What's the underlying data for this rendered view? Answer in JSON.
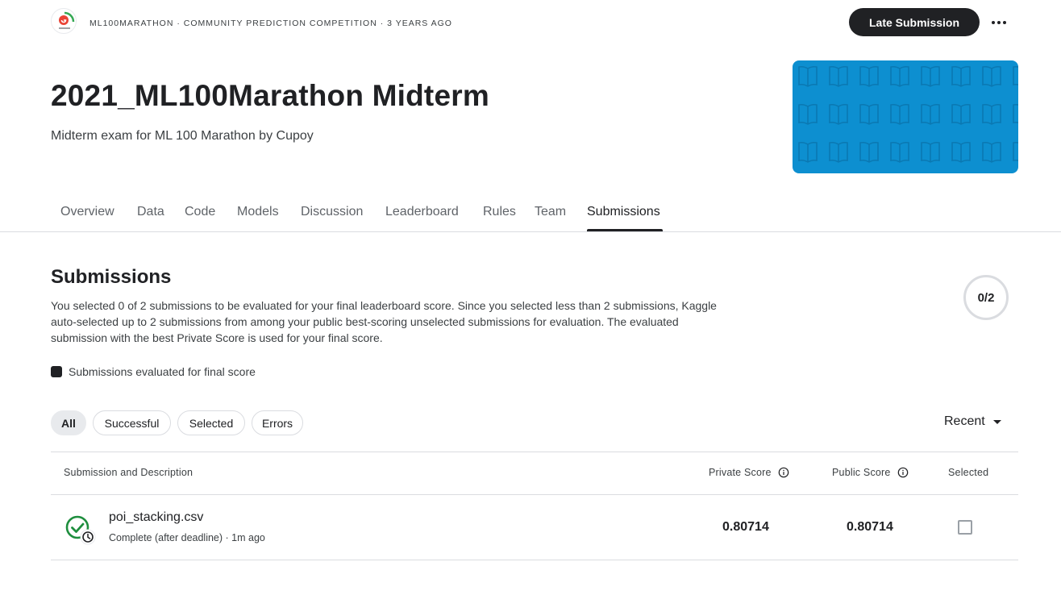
{
  "app": {
    "breadcrumb": "ML100MARATHON · COMMUNITY PREDICTION COMPETITION · 3 YEARS AGO",
    "logo_icon": "cupoy-logo",
    "late_submission_label": "Late Submission",
    "more_icon": "more-horizontal-icon"
  },
  "header": {
    "title": "2021_ML100Marathon Midterm",
    "subtitle": "Midterm exam for ML 100 Marathon by Cupoy",
    "banner_color": "#0d8fd0"
  },
  "tabs": [
    {
      "label": "Overview"
    },
    {
      "label": "Data"
    },
    {
      "label": "Code"
    },
    {
      "label": "Models"
    },
    {
      "label": "Discussion"
    },
    {
      "label": "Leaderboard"
    },
    {
      "label": "Rules"
    },
    {
      "label": "Team"
    },
    {
      "label": "Submissions",
      "active": true
    }
  ],
  "submissions": {
    "title": "Submissions",
    "description": "You selected 0 of 2 submissions to be evaluated for your final leaderboard score. Since you selected less than 2 submissions, Kaggle auto-selected up to 2 submissions from among your public best-scoring unselected submissions for evaluation. The evaluated submission with the best Private Score is used for your final score.",
    "selected_count": "0/2",
    "legend_label": "Submissions evaluated for final score"
  },
  "filters": {
    "chips": [
      {
        "label": "All",
        "active": true
      },
      {
        "label": "Successful"
      },
      {
        "label": "Selected"
      },
      {
        "label": "Errors"
      }
    ],
    "sort_label": "Recent"
  },
  "table": {
    "headers": {
      "submission": "Submission and Description",
      "private_score": "Private Score",
      "public_score": "Public Score",
      "selected": "Selected"
    },
    "rows": [
      {
        "file_name": "poi_stacking.csv",
        "status": "Complete (after deadline) · 1m ago",
        "private_score": "0.80714",
        "public_score": "0.80714",
        "selected": false,
        "status_icon": "success-check-clock-icon",
        "status_color": "#1e8e3e"
      }
    ]
  }
}
